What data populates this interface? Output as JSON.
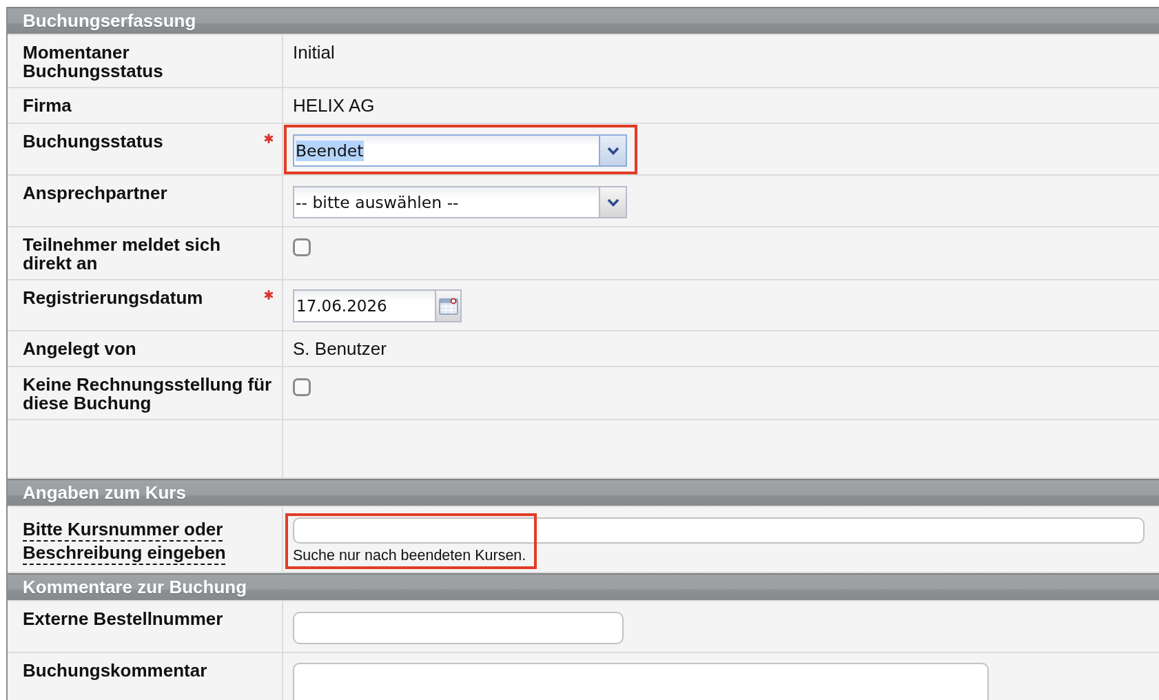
{
  "sections": [
    {
      "title": "Buchungserfassung",
      "rows": [
        {
          "kind": "text",
          "label": "Momentaner Buchungsstatus",
          "required": false,
          "has_tooltip": false,
          "highlighted": false,
          "value": "Initial"
        },
        {
          "kind": "text",
          "label": "Firma",
          "required": false,
          "has_tooltip": false,
          "highlighted": false,
          "value": "HELIX AG"
        },
        {
          "kind": "select",
          "label": "Buchungsstatus",
          "required": true,
          "has_tooltip": false,
          "highlighted": true,
          "value": "Beendet",
          "focused": true,
          "value_selected": true
        },
        {
          "kind": "select",
          "label": "Ansprechpartner",
          "required": false,
          "has_tooltip": false,
          "highlighted": false,
          "value": "-- bitte auswählen --",
          "focused": false,
          "value_selected": false
        },
        {
          "kind": "checkbox",
          "label": "Teilnehmer meldet sich direkt an",
          "required": false,
          "has_tooltip": false,
          "highlighted": false,
          "checked": false
        },
        {
          "kind": "date",
          "label": "Registrierungsdatum",
          "required": true,
          "has_tooltip": false,
          "highlighted": false,
          "value": "17.06.2026"
        },
        {
          "kind": "text",
          "label": "Angelegt von",
          "required": false,
          "has_tooltip": false,
          "highlighted": false,
          "value": "S. Benutzer"
        },
        {
          "kind": "checkbox",
          "label": "Keine Rechnungsstellung für diese Buchung",
          "required": false,
          "has_tooltip": false,
          "highlighted": false,
          "checked": false
        },
        {
          "kind": "blank"
        }
      ]
    },
    {
      "title": "Angaben zum Kurs",
      "rows": [
        {
          "kind": "search",
          "label": "Bitte Kursnummer oder Beschreibung eingeben",
          "required": false,
          "has_tooltip": true,
          "highlighted": true,
          "hint": "Suche nur nach beendeten Kursen."
        }
      ]
    },
    {
      "title": "Kommentare zur Buchung",
      "rows": [
        {
          "kind": "input",
          "label": "Externe Bestellnummer",
          "required": false,
          "has_tooltip": false,
          "highlighted": false
        },
        {
          "kind": "textarea",
          "label": "Buchungskommentar",
          "required": false,
          "has_tooltip": false,
          "highlighted": false
        }
      ]
    }
  ]
}
